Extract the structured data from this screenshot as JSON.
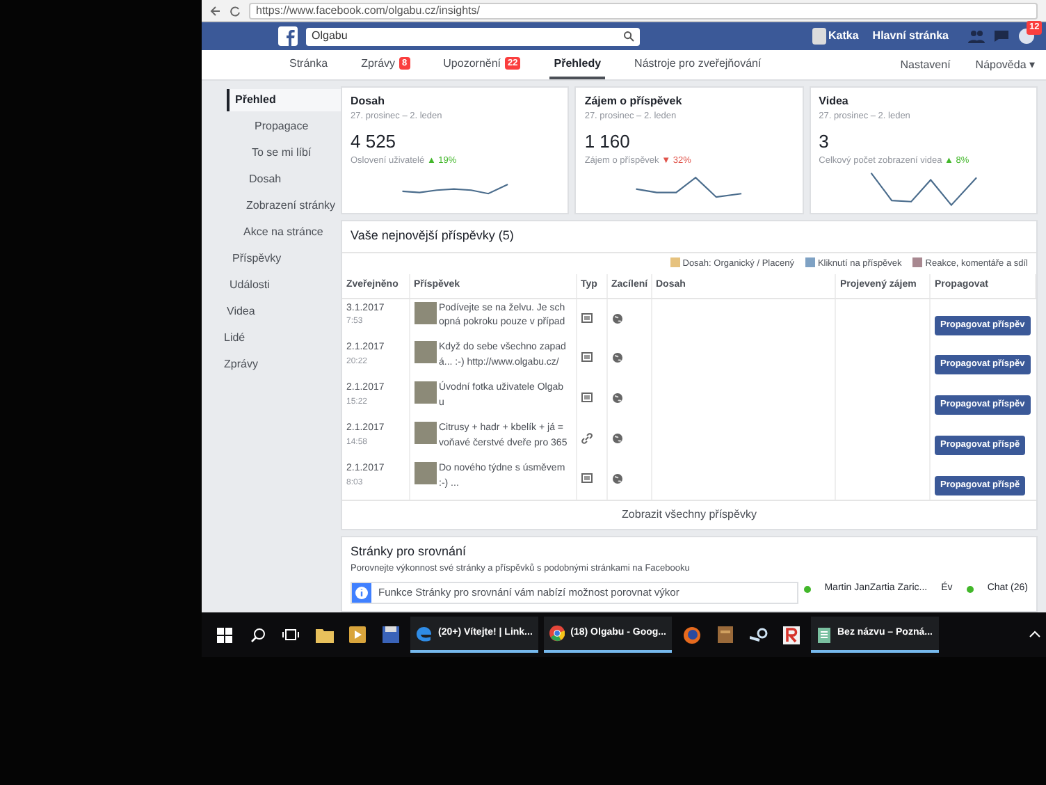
{
  "browser": {
    "url": "https://www.facebook.com/olgabu.cz/insights/"
  },
  "header": {
    "search_value": "Olgabu",
    "user": "Katka",
    "home": "Hlavní stránka",
    "notification_count": "12"
  },
  "page_tabs": [
    {
      "label": "Stránka",
      "selected": false
    },
    {
      "label": "Zprávy",
      "badge": "8",
      "selected": false
    },
    {
      "label": "Upozornění",
      "badge": "22",
      "selected": false
    },
    {
      "label": "Přehledy",
      "selected": true
    },
    {
      "label": "Nástroje pro zveřejňování",
      "selected": false
    }
  ],
  "page_links": [
    "Nastavení",
    "Nápověda ▾"
  ],
  "sidebar": {
    "items": [
      {
        "label": "Přehled",
        "selected": true,
        "children": [
          {
            "label": "Propagace",
            "selected": false
          },
          {
            "label": "To se mi líbí",
            "selected": false
          },
          {
            "label": "Dosah",
            "selected": false
          },
          {
            "label": "Zobrazení stránky",
            "selected": false
          },
          {
            "label": "Akce na stránce",
            "selected": false
          }
        ]
      },
      {
        "label": "Příspěvky",
        "selected": false
      },
      {
        "label": "Události",
        "selected": false
      },
      {
        "label": "Videa",
        "selected": false
      },
      {
        "label": "Lidé",
        "selected": false
      },
      {
        "label": "Zprávy",
        "selected": false
      }
    ]
  },
  "cards": [
    {
      "title": "Dosah",
      "period": "27. prosinec – 2. leden",
      "value": "4 525",
      "caption": "Oslovení uživatelé",
      "trend": "▲ 19%",
      "rising": true
    },
    {
      "title": "Zájem o příspěvek",
      "period": "27. prosinec – 2. leden",
      "value": "1 160",
      "caption": "Zájem o příspěvek",
      "trend": "▼ 32%",
      "rising": false
    },
    {
      "title": "Videa",
      "period": "27. prosinec – 2. leden",
      "value": "3",
      "caption": "Celkový počet zobrazení videa",
      "trend": "▲ 8%",
      "rising": true
    }
  ],
  "posts": {
    "title": "Vaše nejnovější příspěvky (5)",
    "legend": [
      {
        "label": "Dosah: Organický / Placený",
        "color": "#e6c27e"
      },
      {
        "label": "Kliknutí na příspěvek",
        "color": "#7fa2c4"
      },
      {
        "label": "Reakce, komentáře a sdíl",
        "color": "#a88890"
      }
    ],
    "columns": [
      "Zveřejněno",
      "Příspěvek",
      "Typ",
      "Zacílení",
      "Dosah",
      "Projevený zájem",
      "Propagovat"
    ],
    "rows": [
      {
        "date": "3.1.2017",
        "time": "7:53",
        "text": "Podívejte se na želvu. Je sch opná pokroku pouze v případ",
        "kind": "photo",
        "button": "Propagovat příspěv"
      },
      {
        "date": "2.1.2017",
        "time": "20:22",
        "text": "Když do sebe všechno zapad á... :-) http://www.olgabu.cz/",
        "kind": "photo",
        "button": "Propagovat příspěv"
      },
      {
        "date": "2.1.2017",
        "time": "15:22",
        "text": "Úvodní fotka uživatele Olgab u",
        "kind": "photo",
        "button": "Propagovat příspěv"
      },
      {
        "date": "2.1.2017",
        "time": "14:58",
        "text": "Citrusy + hadr + kbelík + já = voňavé čerstvé dveře pro 365",
        "kind": "link",
        "button": "Propagovat příspě"
      },
      {
        "date": "2.1.2017",
        "time": "8:03",
        "text": "Do nového týdne s úsměvem :-) ...",
        "kind": "photo",
        "button": "Propagovat příspě"
      }
    ],
    "footer_link": "Zobrazit všechny příspěvky"
  },
  "comparison": {
    "title": "Stránky pro srovnání",
    "subtitle": "Porovnejte výkonnost své stránky a příspěvků s podobnými stránkami na Facebooku",
    "info": "Funkce Stránky pro srovnání vám nabízí možnost porovnat výkor"
  },
  "chat": {
    "contact": "Martin JanZartia Zaric...",
    "extra": "Év",
    "chat": "Chat (26)"
  },
  "taskbar": [
    {
      "kind": "start"
    },
    {
      "kind": "search"
    },
    {
      "kind": "taskview"
    },
    {
      "kind": "folder"
    },
    {
      "kind": "media"
    },
    {
      "kind": "disk"
    },
    {
      "kind": "edge",
      "label": "(20+) Vítejte! | Link...",
      "running": true
    },
    {
      "kind": "chrome",
      "label": "(18) Olgabu - Goog...",
      "running": true
    },
    {
      "kind": "firefox"
    },
    {
      "kind": "box"
    },
    {
      "kind": "steam"
    },
    {
      "kind": "r"
    },
    {
      "kind": "notes",
      "label": "Bez názvu – Pozná...",
      "running": true
    }
  ]
}
